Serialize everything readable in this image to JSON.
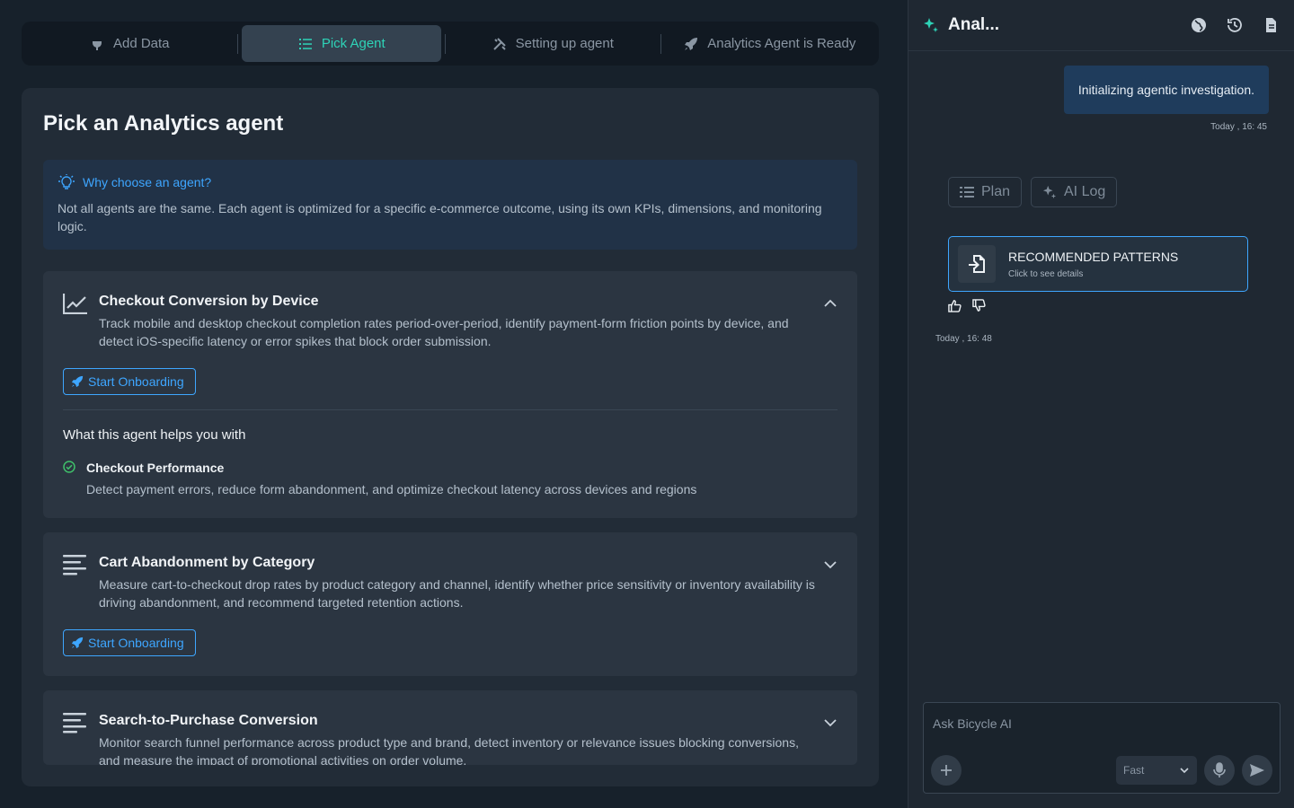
{
  "stepper": {
    "steps": [
      {
        "label": "Add Data",
        "icon": "plug-icon",
        "active": false
      },
      {
        "label": "Pick Agent",
        "icon": "list-icon",
        "active": true
      },
      {
        "label": "Setting up agent",
        "icon": "tools-icon",
        "active": false
      },
      {
        "label": "Analytics Agent is Ready",
        "icon": "rocket-icon",
        "active": false
      }
    ]
  },
  "page": {
    "title": "Pick an Analytics agent",
    "info": {
      "heading": "Why choose an agent?",
      "body": "Not all agents are the same. Each agent is optimized for a specific e-commerce outcome, using its own KPIs, dimensions, and monitoring logic."
    }
  },
  "agents": [
    {
      "title": "Checkout Conversion by Device",
      "description": "Track mobile and desktop checkout completion rates period-over-period, identify payment-form friction points by device, and detect iOS-specific latency or error spikes that block order submission.",
      "button": "Start Onboarding",
      "expanded": true,
      "helps_title": "What this agent helps you with",
      "feature_title": "Checkout Performance",
      "feature_desc": "Detect payment errors, reduce form abandonment, and optimize checkout latency across devices and regions"
    },
    {
      "title": "Cart Abandonment by Category",
      "description": "Measure cart-to-checkout drop rates by product category and channel, identify whether price sensitivity or inventory availability is driving abandonment, and recommend targeted retention actions.",
      "button": "Start Onboarding",
      "expanded": false
    },
    {
      "title": "Search-to-Purchase Conversion",
      "description": "Monitor search funnel performance across product type and brand, detect inventory or relevance issues blocking conversions, and measure the impact of promotional activities on order volume.",
      "expanded": false
    }
  ],
  "sidebar": {
    "title": "Anal...",
    "message": "Initializing agentic investigation.",
    "message_time": "Today , 16: 45",
    "chips": {
      "plan": "Plan",
      "ai_log": "AI Log"
    },
    "pattern": {
      "title": "RECOMMENDED PATTERNS",
      "subtitle": "Click to see details"
    },
    "reply_time": "Today , 16: 48",
    "composer": {
      "placeholder": "Ask Bicycle AI",
      "mode": "Fast"
    }
  },
  "colors": {
    "accent": "#2ed3b7",
    "link": "#3ea6ff",
    "info_bg": "#213247"
  }
}
